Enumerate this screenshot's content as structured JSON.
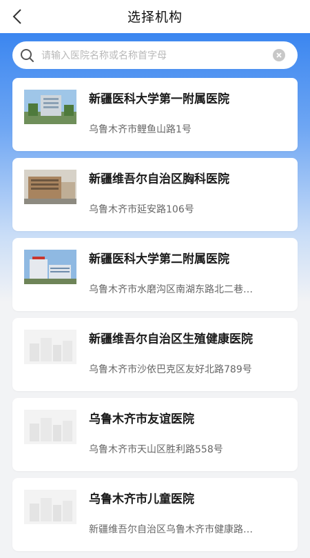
{
  "header": {
    "back_icon": "chevron-left-icon",
    "title": "选择机构"
  },
  "search": {
    "icon": "search-icon",
    "placeholder": "请输入医院名称或名称首字母",
    "value": "",
    "clear_icon": "clear-icon"
  },
  "hospitals": [
    {
      "name": "新疆医科大学第一附属医院",
      "address": "乌鲁木齐市鲤鱼山路1号",
      "image": "hospital-photo"
    },
    {
      "name": "新疆维吾尔自治区胸科医院",
      "address": "乌鲁木齐市延安路106号",
      "image": "hospital-photo"
    },
    {
      "name": "新疆医科大学第二附属医院",
      "address": "乌鲁木齐市水磨沟区南湖东路北二巷…",
      "image": "hospital-photo"
    },
    {
      "name": "新疆维吾尔自治区生殖健康医院",
      "address": "乌鲁木齐市沙依巴克区友好北路789号",
      "image": "placeholder-image"
    },
    {
      "name": "乌鲁木齐市友谊医院",
      "address": "乌鲁木齐市天山区胜利路558号",
      "image": "placeholder-image"
    },
    {
      "name": "乌鲁木齐市儿童医院",
      "address": "新疆维吾尔自治区乌鲁木齐市健康路…",
      "image": "placeholder-image"
    }
  ],
  "colors": {
    "accent_blue": "#3b86f0",
    "background": "#f2f3f5"
  }
}
